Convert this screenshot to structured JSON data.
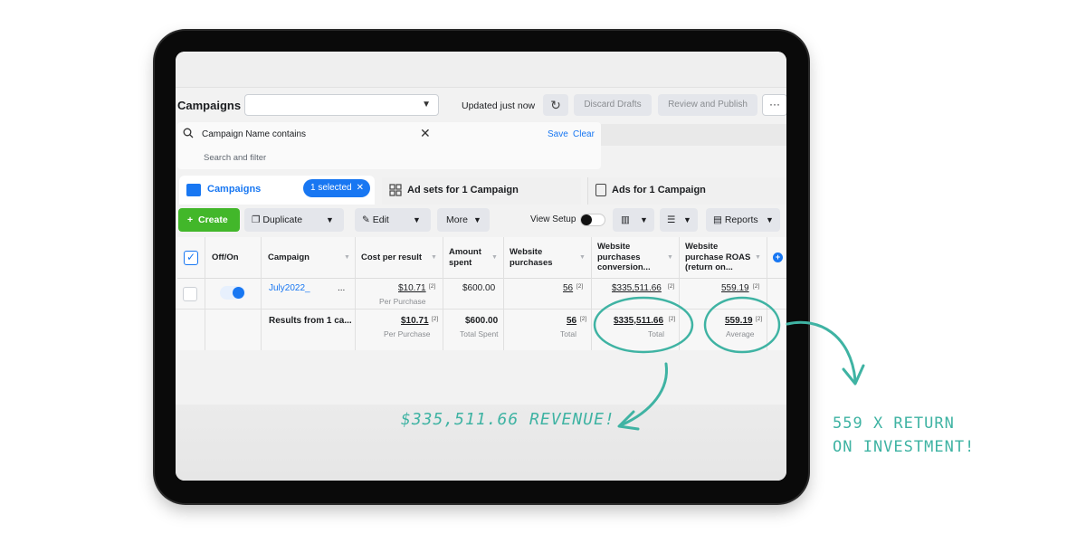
{
  "header": {
    "title": "Campaigns",
    "updated_text": "Updated just now",
    "discard_label": "Discard Drafts",
    "review_label": "Review and Publish",
    "more_label": "···"
  },
  "search": {
    "filter_text": "Campaign Name contains",
    "save_label": "Save",
    "clear_label": "Clear",
    "placeholder": "Search and filter"
  },
  "tabs": {
    "campaigns_label": "Campaigns",
    "selected_label": "1 selected",
    "adsets_label": "Ad sets for 1 Campaign",
    "ads_label": "Ads for 1 Campaign"
  },
  "toolbar": {
    "create_label": "Create",
    "duplicate_label": "Duplicate",
    "edit_label": "Edit",
    "more_label": "More",
    "view_setup_label": "View Setup",
    "reports_label": "Reports"
  },
  "table": {
    "headers": {
      "offon": "Off/On",
      "campaign": "Campaign",
      "cost": "Cost per result",
      "amount1": "Amount",
      "amount2": "spent",
      "purchases1": "Website",
      "purchases2": "purchases",
      "conv1": "Website",
      "conv2": "purchases",
      "conv3": "conversion...",
      "roas1": "Website",
      "roas2": "purchase ROAS",
      "roas3": "(return on..."
    },
    "row": {
      "campaign": "July2022_",
      "campaign_more": "...",
      "cost": "$10.71",
      "cost_sup": "[2]",
      "cost_sub": "Per Purchase",
      "amount": "$600.00",
      "purchases": "56",
      "purchases_sup": "[2]",
      "conversion": "$335,511.66",
      "conversion_sup": "[2]",
      "roas": "559.19",
      "roas_sup": "[2]"
    },
    "totals": {
      "label": "Results from 1 ca...",
      "cost": "$10.71",
      "cost_sup": "[2]",
      "cost_sub": "Per Purchase",
      "amount": "$600.00",
      "amount_sub": "Total Spent",
      "purchases": "56",
      "purchases_sup": "[2]",
      "purchases_sub": "Total",
      "conversion": "$335,511.66",
      "conversion_sup": "[2]",
      "conversion_sub": "Total",
      "roas": "559.19",
      "roas_sup": "[2]",
      "roas_sub": "Average"
    }
  },
  "annotations": {
    "revenue": "$335,511.66 REVENUE!",
    "roi_line1": "559 X RETURN",
    "roi_line2": "ON INVESTMENT!"
  },
  "colors": {
    "accent": "#1877f2",
    "create_green": "#42b72a",
    "annotation_teal": "#3fb3a3"
  }
}
